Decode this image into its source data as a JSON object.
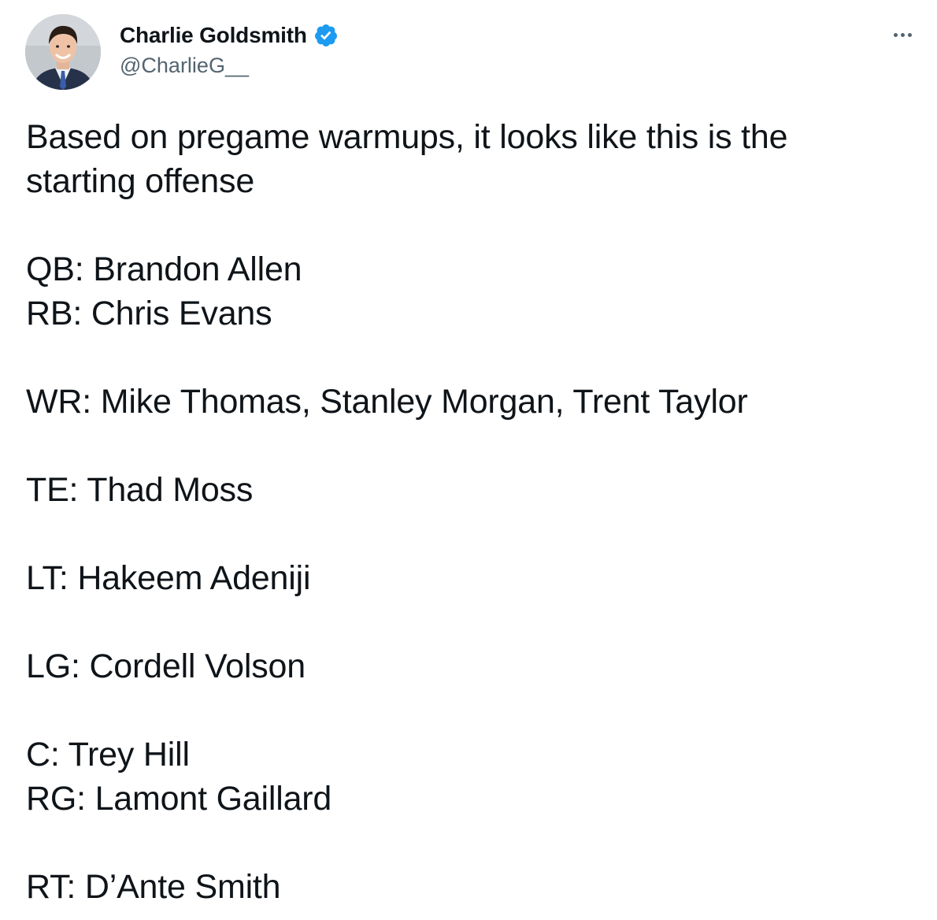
{
  "author": {
    "display_name": "Charlie Goldsmith",
    "handle": "@CharlieG__",
    "verified": true,
    "verified_icon": "verified-badge-icon",
    "avatar_icon": "profile-photo"
  },
  "menu": {
    "icon": "more-options-icon"
  },
  "tweet": {
    "lines": [
      "Based on pregame warmups, it looks like this is the",
      "starting offense",
      "",
      "QB: Brandon Allen",
      "RB: Chris Evans",
      "",
      "WR: Mike Thomas, Stanley Morgan, Trent Taylor",
      "",
      "TE: Thad Moss",
      "",
      "LT: Hakeem Adeniji",
      "",
      "LG: Cordell Volson",
      "",
      "C: Trey Hill",
      "RG: Lamont Gaillard",
      "",
      "RT: D’Ante Smith"
    ]
  },
  "colors": {
    "text": "#0f1419",
    "secondary": "#536471",
    "verified": "#1d9bf0"
  }
}
